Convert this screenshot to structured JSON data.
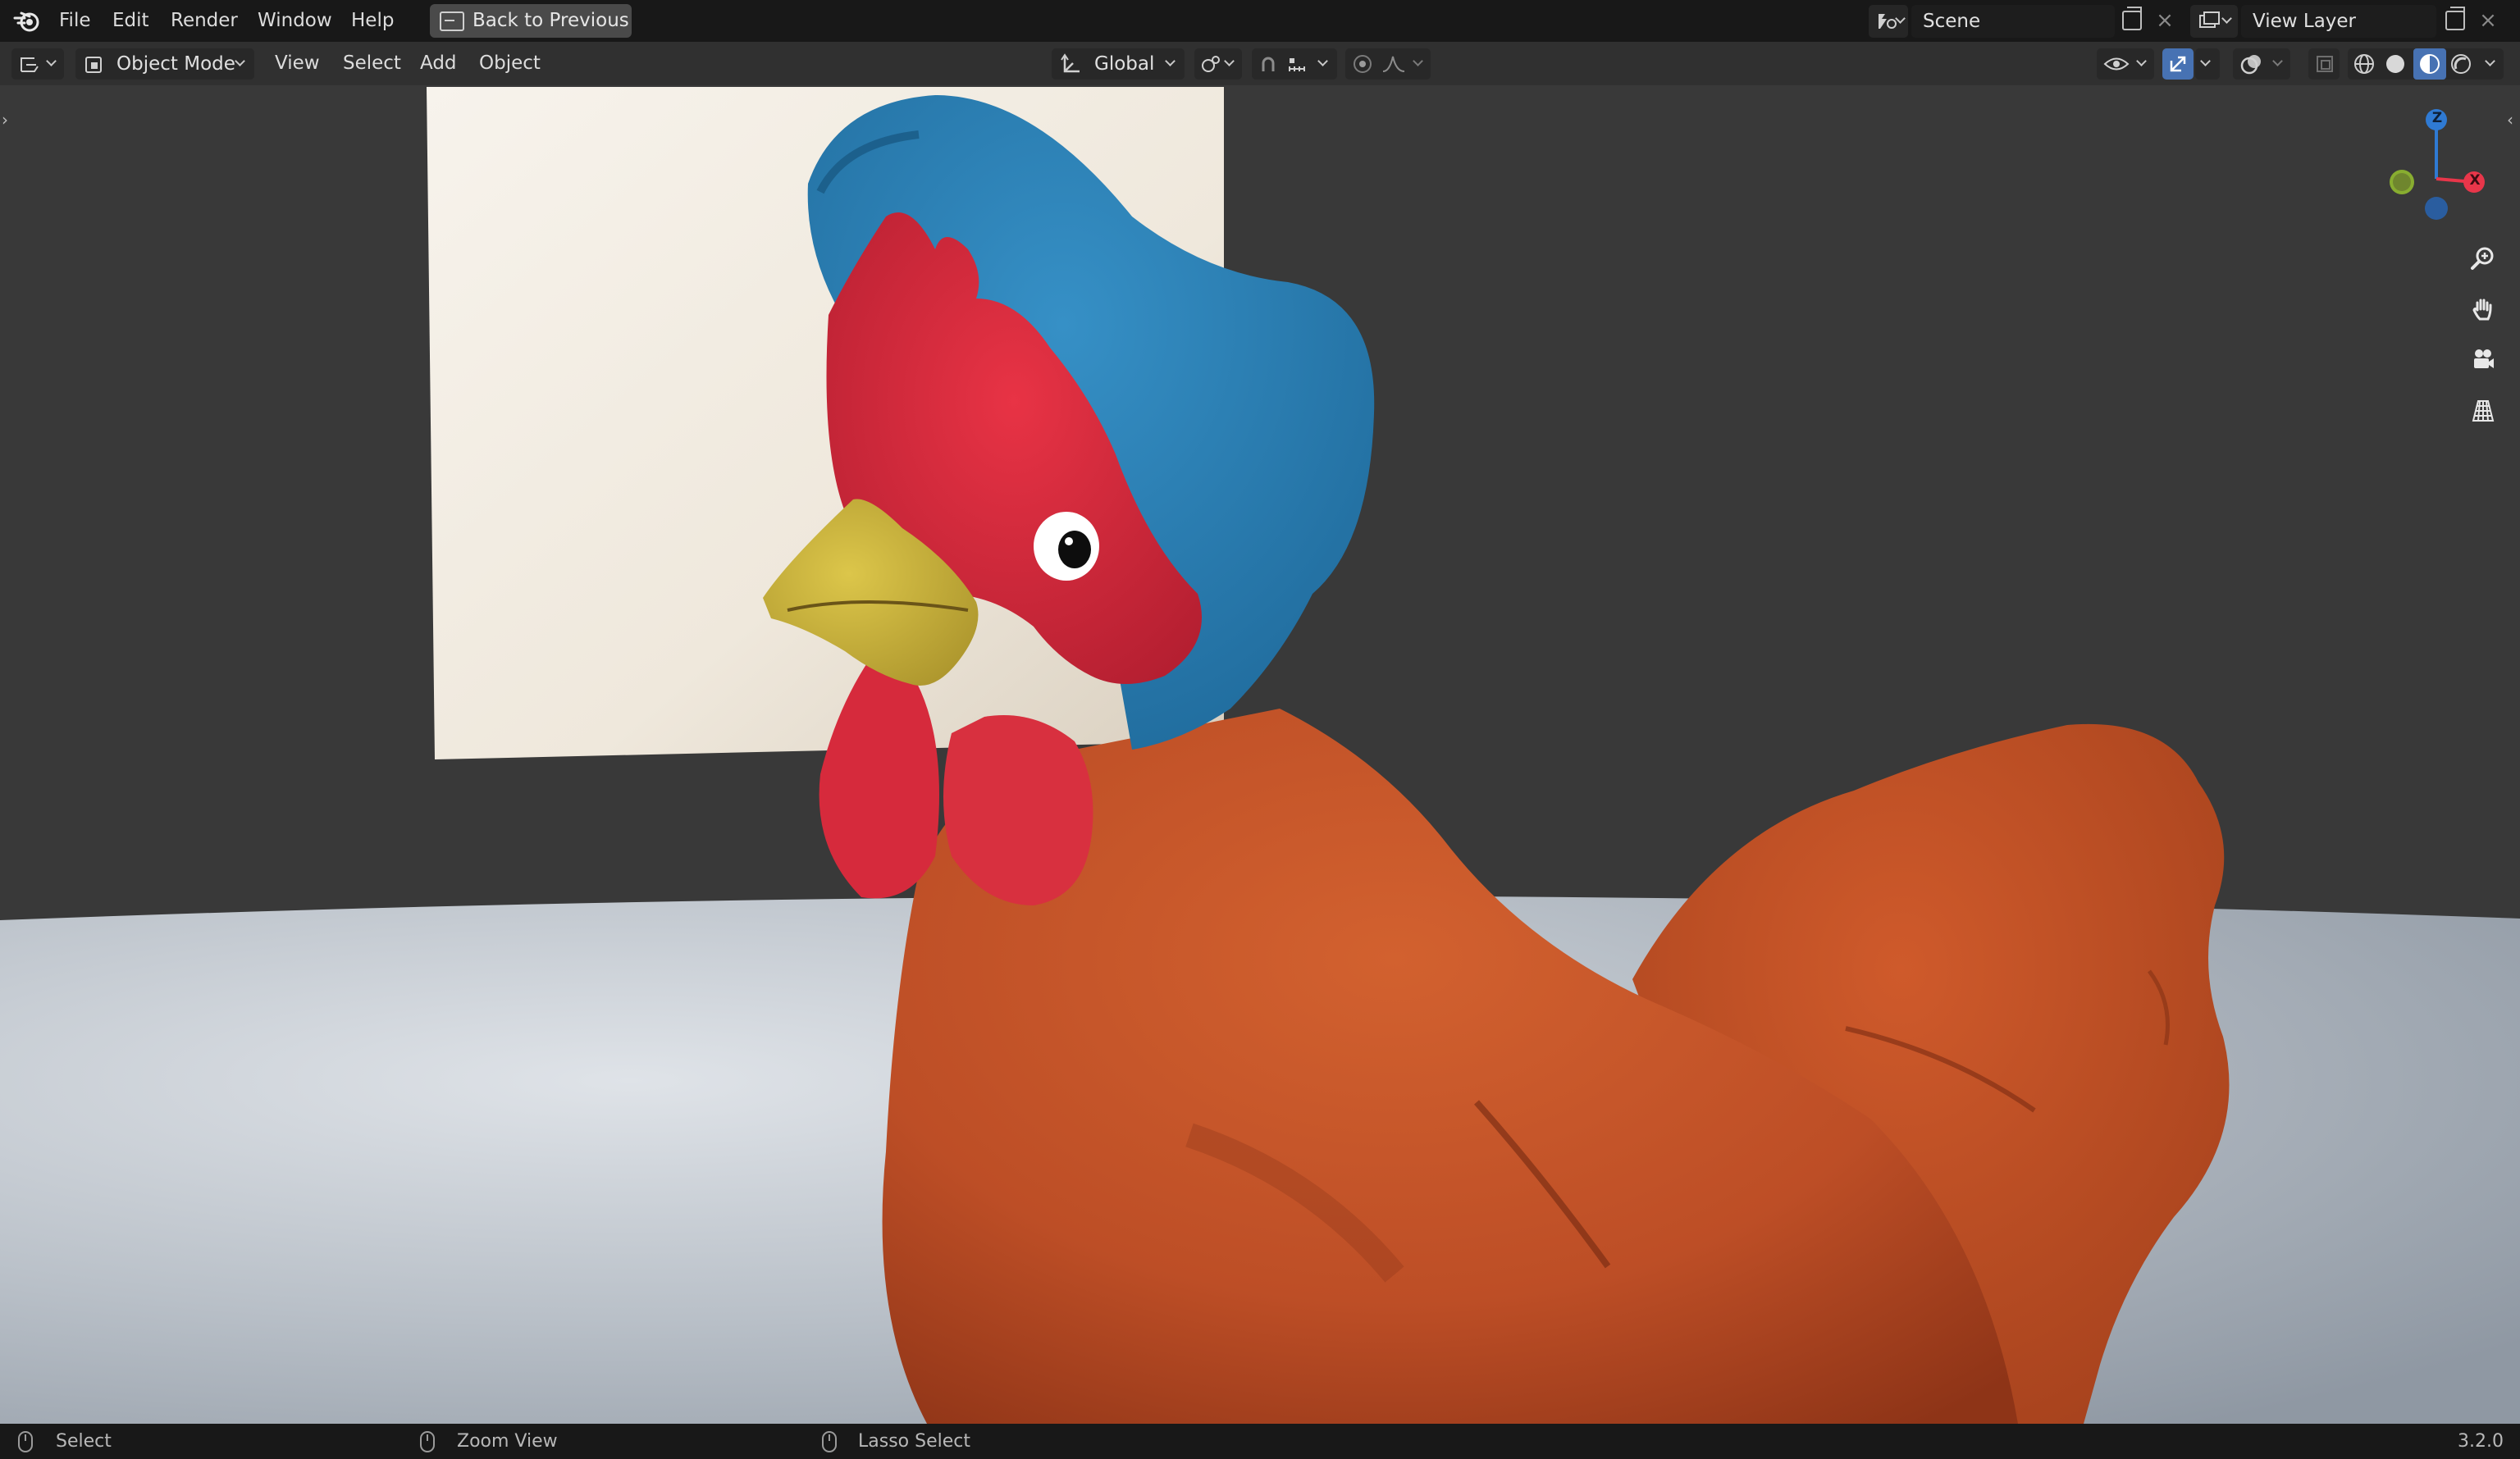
{
  "topbar": {
    "menus": [
      "File",
      "Edit",
      "Render",
      "Window",
      "Help"
    ],
    "back_label": "Back to Previous",
    "scene_name": "Scene",
    "view_layer_name": "View Layer"
  },
  "header": {
    "mode": "Object Mode",
    "menus": [
      "View",
      "Select",
      "Add",
      "Object"
    ],
    "transform_orientation": "Global"
  },
  "gizmo": {
    "z_label": "Z",
    "x_label": "X",
    "colors": {
      "x": "#e8364a",
      "y": "#8cb32f",
      "z": "#2f7ad3",
      "neg_z": "#2a5d9f"
    }
  },
  "icons": {
    "top": [
      "blender-logo-icon",
      "back-to-previous-icon",
      "scene-icon",
      "new-scene-icon",
      "close-icon",
      "view-layer-icon",
      "new-view-layer-icon",
      "close-icon"
    ],
    "header": [
      "editor-type-icon",
      "object-mode-icon",
      "transform-orientation-icon",
      "pivot-icon",
      "snap-icon",
      "snap-increment-icon",
      "proportional-edit-icon",
      "falloff-icon",
      "visibility-icon",
      "gizmo-icon",
      "overlay-icon",
      "xray-icon",
      "wireframe-icon",
      "solid-icon",
      "material-preview-icon",
      "rendered-icon"
    ],
    "nav": [
      "zoom-icon",
      "pan-hand-icon",
      "camera-icon",
      "grid-perspective-icon"
    ]
  },
  "status": {
    "items": [
      "Select",
      "Zoom View",
      "Lasso Select"
    ],
    "version": "3.2.0"
  },
  "colors": {
    "accent": "#4772b3",
    "chicken_body": "#c2522a",
    "bonnet": "#2d82b8",
    "comb": "#d92b3d",
    "beak": "#d1b83a"
  }
}
